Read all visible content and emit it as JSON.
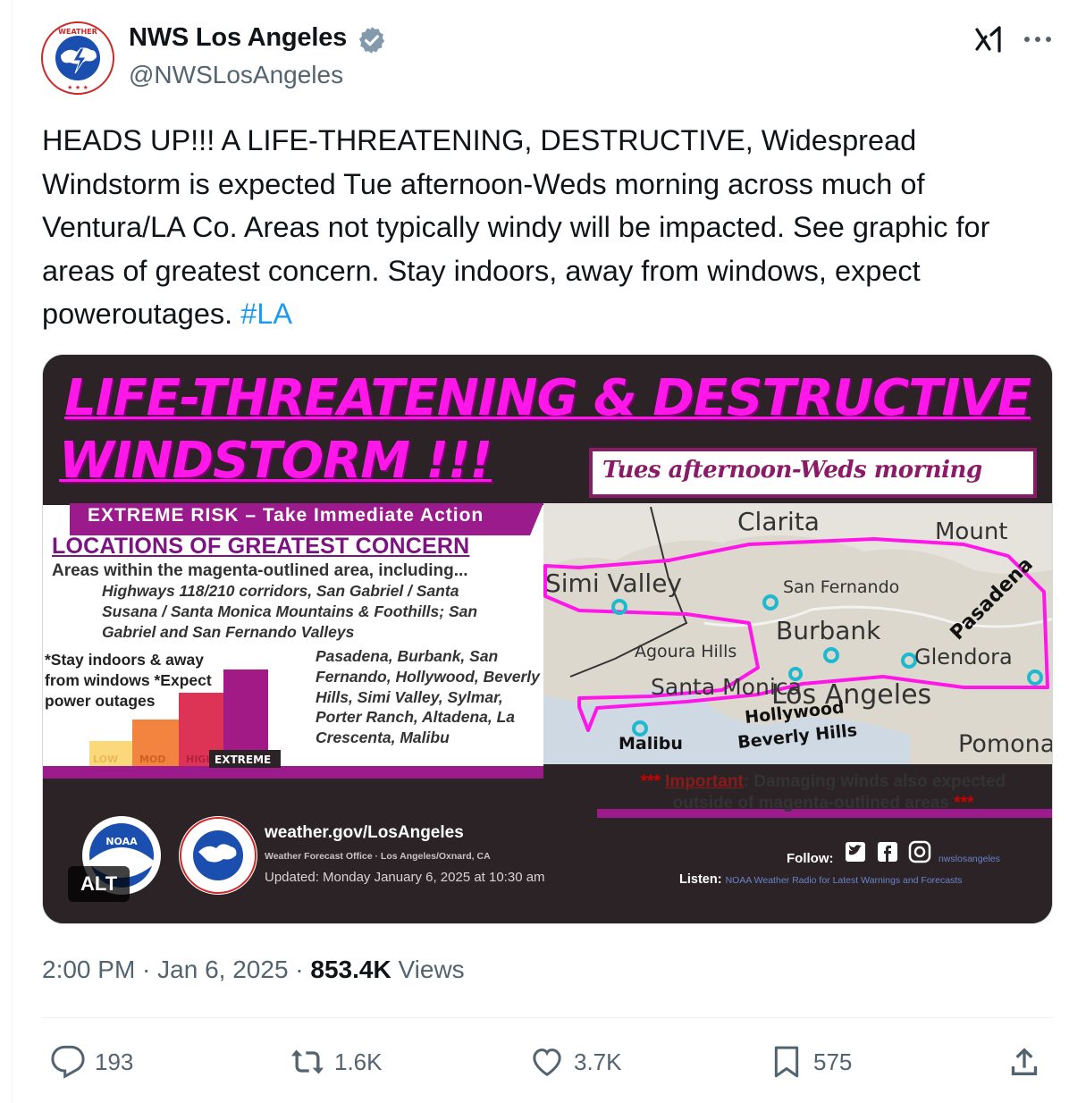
{
  "author": {
    "name": "NWS Los Angeles",
    "handle": "@NWSLosAngeles",
    "verified": true,
    "avatar_icon": "nws-logo-icon"
  },
  "tweet": {
    "text": "HEADS UP!!! A LIFE-THREATENING, DESTRUCTIVE, Widespread Windstorm is expected Tue afternoon-Weds morning across much of Ventura/LA Co. Areas not typically windy will be impacted. See graphic for areas of greatest concern. Stay indoors, away from windows, expect poweroutages.",
    "hashtag": "#LA"
  },
  "media": {
    "alt_badge": "ALT",
    "title_line1": "LIFE-THREATENING & DESTRUCTIVE",
    "title_line2": "WINDSTORM !!!",
    "timeframe": "Tues afternoon-Weds morning",
    "risk_banner": "EXTREME RISK – Take Immediate Action",
    "locations_heading": "LOCATIONS OF GREATEST CONCERN",
    "areas_intro": "Areas within the magenta-outlined area, including...",
    "highways": "Highways 118/210 corridors, San Gabriel / Santa Susana / Santa Monica Mountains & Foothills; San Gabriel and San Fernando Valleys",
    "advice": "*Stay indoors & away from windows *Expect power outages",
    "cities": "Pasadena, Burbank, San Fernando, Hollywood, Beverly Hills, Simi Valley, Sylmar, Porter Ranch, Altadena, La Crescenta, Malibu",
    "risk_levels": [
      "LOW",
      "MOD",
      "HIGH",
      "EXTREME"
    ],
    "map_labels": {
      "clarita": "Clarita",
      "mount": "Mount",
      "simi": "Simi Valley",
      "san_fernando": "San Fernando",
      "burbank": "Burbank",
      "pasadena": "Pasadena",
      "glendora": "Glendora",
      "agoura": "Agoura Hills",
      "santa_monica": "Santa Monica",
      "los_angeles": "Los Angeles",
      "hollywood": "Hollywood",
      "beverly": "Beverly Hills",
      "malibu": "Malibu",
      "pomona": "Pomona"
    },
    "important_stars": "***",
    "important_word": "Important",
    "important_rest": ": Damaging winds also expected outside of magenta-outlined areas",
    "website": "weather.gov/LosAngeles",
    "office": "Weather Forecast Office · Los Angeles/Oxnard, CA",
    "updated": "Updated: Monday January 6, 2025 at 10:30 am",
    "follow_label": "Follow:",
    "social_handle": "nwslosangeles",
    "listen_label": "Listen:",
    "listen_text": "NOAA Weather Radio for Latest Warnings and Forecasts",
    "noaa_text": "NOAA",
    "colors": {
      "magenta": "#ff17ea",
      "dark": "#2c2326",
      "purple": "#8a1b66"
    }
  },
  "meta": {
    "time": "2:00 PM",
    "date": "Jan 6, 2025",
    "views_count": "853.4K",
    "views_label": "Views"
  },
  "actions": {
    "replies": "193",
    "reposts": "1.6K",
    "likes": "3.7K",
    "bookmarks": "575"
  }
}
